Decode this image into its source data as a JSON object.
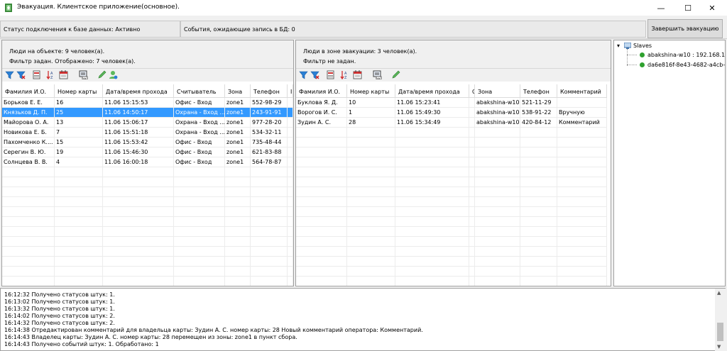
{
  "window": {
    "title": "Эвакуация. Клиентское приложение(основное).",
    "minimize": "—",
    "maximize": "☐",
    "close": "✕"
  },
  "status": {
    "connection": "Статус подключения к базе данных: Активно",
    "pending": "События, ожидающие запись в БД: 0",
    "finish_button": "Завершить эвакуацию"
  },
  "left_panel": {
    "people_count": "Люди на объекте: 9 человек(а).",
    "filter_info": "Фильтр задан. Отображено: 7 человек(а).",
    "toolbar_icons": [
      "filter-icon",
      "clear-filter-icon",
      "export-icon",
      "sort-icon",
      "calendar-icon",
      "report-icon",
      "edit-icon",
      "user-icon"
    ],
    "columns": [
      "Фамилия И.О.",
      "Номер карты",
      "Дата/время прохода",
      "Считыватель",
      "Зона",
      "Телефон",
      "I"
    ],
    "rows": [
      [
        "Борьков Е. Е.",
        "16",
        "11.06  15:15:53",
        "Офис - Вход",
        "zone1",
        "552-98-29"
      ],
      [
        "Князьков Д. П.",
        "25",
        "11.06  14:50:17",
        "Охрана - Вход ...",
        "zone1",
        "243-91-91"
      ],
      [
        "Майорова О. А.",
        "13",
        "11.06  15:06:17",
        "Охрана - Вход ...",
        "zone1",
        "977-28-20"
      ],
      [
        "Новикова Е. Б.",
        "7",
        "11.06  15:51:18",
        "Охрана - Вход ...",
        "zone1",
        "534-32-11"
      ],
      [
        "Пахомченко К....",
        "15",
        "11.06  15:53:42",
        "Офис - Вход",
        "zone1",
        "735-48-44"
      ],
      [
        "Серегин В. Ю.",
        "19",
        "11.06  15:46:30",
        "Офис - Вход",
        "zone1",
        "621-83-88"
      ],
      [
        "Солнцева В. В.",
        "4",
        "11.06  16:00:18",
        "Офис - Вход",
        "zone1",
        "564-78-87"
      ]
    ],
    "selected_row": 1
  },
  "right_panel": {
    "people_count": "Люди в зоне эвакуации: 3 человек(а).",
    "filter_info": "Фильтр не задан.",
    "toolbar_icons": [
      "filter-icon",
      "clear-filter-icon",
      "export-icon",
      "sort-icon",
      "calendar-icon",
      "report-icon",
      "edit-icon"
    ],
    "columns": [
      "Фамилия И.О.",
      "Номер карты",
      "Дата/время прохода",
      "С",
      "Зона",
      "Телефон",
      "Комментарий"
    ],
    "rows": [
      [
        "Буклова Я. Д.",
        "10",
        "11.06  15:23:41",
        "",
        "abakshina-w10",
        "521-11-29",
        ""
      ],
      [
        "Ворогов И. С.",
        "1",
        "11.06  15:49:30",
        "",
        "abakshina-w10",
        "538-91-22",
        "Вручную"
      ],
      [
        "Зудин А. С.",
        "28",
        "11.06  15:34:49",
        "",
        "abakshina-w10",
        "420-84-12",
        "Комментарий"
      ]
    ]
  },
  "tree": {
    "root": "Slaves",
    "children": [
      "abakshina-w10 : 192.168.1.",
      "da6e816f-8e43-4682-a4cb-1"
    ]
  },
  "log": [
    "16:12:32 Получено статусов штук: 1.",
    "16:13:02 Получено статусов штук: 1.",
    "16:13:32 Получено статусов штук: 1.",
    "16:14:02 Получено статусов штук: 2.",
    "16:14:32 Получено статусов штук: 2.",
    "16:14:38 Отредактирован комментарий для владельца карты: Зудин А. С. номер карты: 28 Новый комментарий  оператора: Комментарий.",
    "16:14:43 Владелец карты: Зудин А. С. номер карты: 28 перемещен из зоны: zone1 в пункт сбора.",
    "16:14:43 Получено событий штук: 1. Обработано: 1"
  ],
  "colors": {
    "selection": "#3399ff",
    "status_green": "#2fa12f",
    "filter_blue": "#2a7fd4"
  }
}
